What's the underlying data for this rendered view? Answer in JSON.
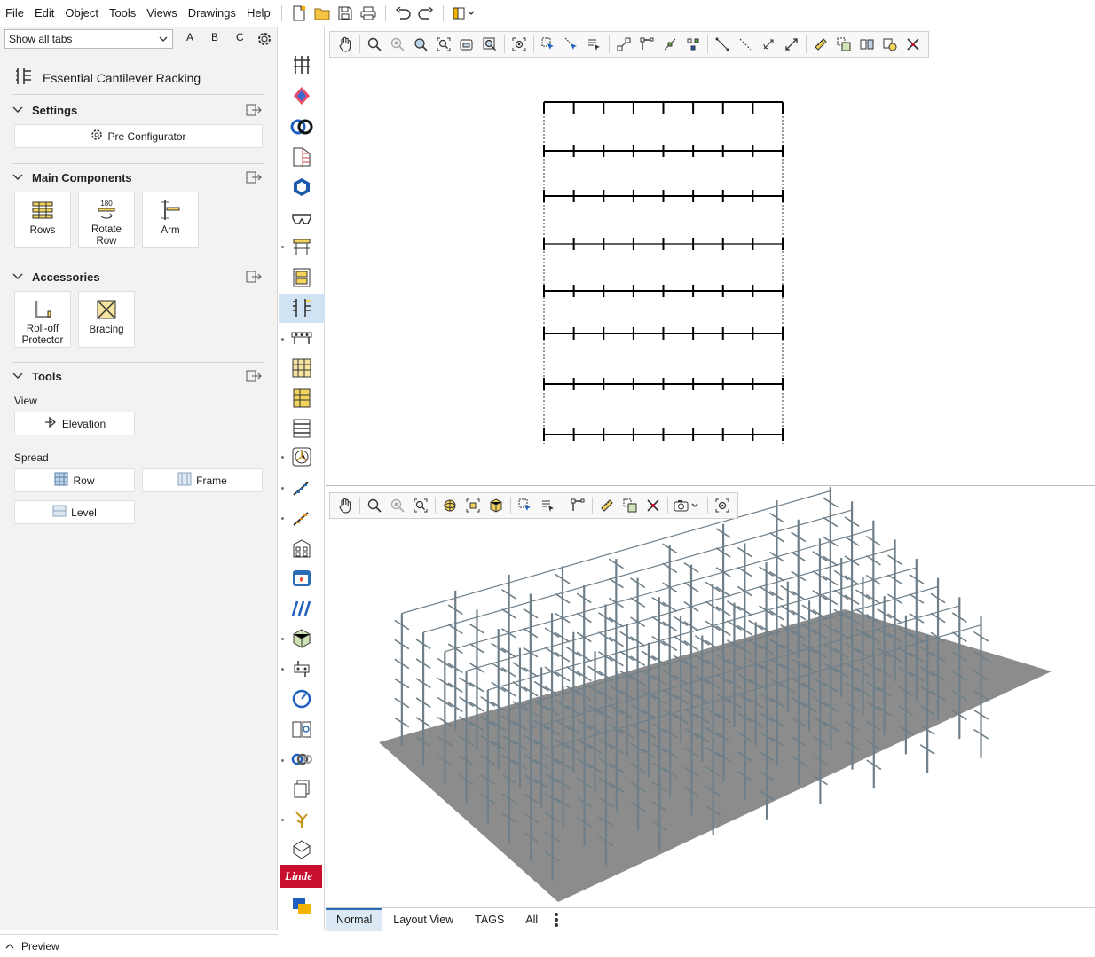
{
  "menu": {
    "items": [
      "File",
      "Edit",
      "Object",
      "Tools",
      "Views",
      "Drawings",
      "Help"
    ]
  },
  "left_panel": {
    "tabs_select_value": "Show all tabs",
    "filter_letters": [
      "A",
      "B",
      "C"
    ],
    "title": "Essential Cantilever Racking",
    "sections": {
      "settings": {
        "label": "Settings",
        "button": "Pre Configurator"
      },
      "main_components": {
        "label": "Main Components",
        "tiles": [
          {
            "label": "Rows",
            "icon": "rows-icon"
          },
          {
            "label": "Rotate Row",
            "icon": "rotate-row-icon",
            "badge": "180"
          },
          {
            "label": "Arm",
            "icon": "arm-icon"
          }
        ]
      },
      "accessories": {
        "label": "Accessories",
        "tiles": [
          {
            "label": "Roll-off Protector",
            "icon": "roll-off-protector-icon"
          },
          {
            "label": "Bracing",
            "icon": "bracing-icon"
          }
        ]
      },
      "tools": {
        "label": "Tools",
        "view_label": "View",
        "elevation_button": "Elevation",
        "spread_label": "Spread",
        "row_button": "Row",
        "frame_button": "Frame",
        "level_button": "Level"
      }
    },
    "preview_label": "Preview"
  },
  "bottom_tabs": [
    "Normal",
    "Layout View",
    "TAGS",
    "All"
  ],
  "active_bottom_tab": "Normal",
  "colors": {
    "accent": "#2a6db5",
    "floor": "#8c8c8c",
    "rack_steel": "#6e7f8a",
    "linde_red": "#c8102e"
  }
}
